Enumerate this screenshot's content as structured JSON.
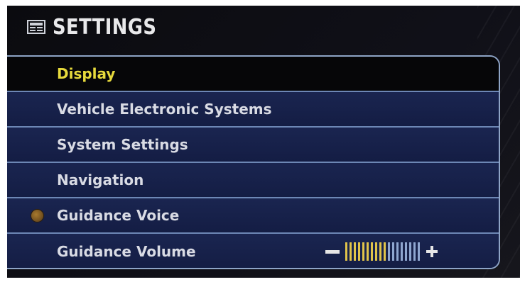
{
  "header": {
    "title": "SETTINGS",
    "icon": "settings-panel-icon"
  },
  "menu": {
    "items": [
      {
        "label": "Display",
        "selected": true
      },
      {
        "label": "Vehicle Electronic Systems"
      },
      {
        "label": "System Settings"
      },
      {
        "label": "Navigation"
      },
      {
        "label": "Guidance Voice",
        "indicator": "status-indicator-icon"
      },
      {
        "label": "Guidance Volume"
      }
    ]
  },
  "volume": {
    "level": 10,
    "max": 18,
    "minus_icon": "minus-icon",
    "plus_icon": "plus-icon"
  },
  "colors": {
    "selected_text": "#e7da3c",
    "normal_text": "#d9dbe4",
    "menu_background": "#141d44",
    "border": "#6d87b5",
    "volume_on": "#e0c34a",
    "volume_off": "#8fa6d0"
  }
}
